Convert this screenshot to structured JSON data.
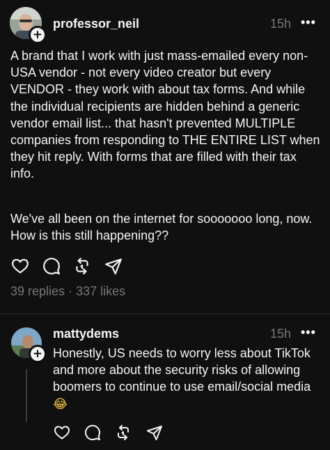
{
  "post": {
    "username": "professor_neil",
    "time": "15h",
    "more_label": "•••",
    "paragraph1": "A brand that I work with just mass-emailed every non-USA vendor - not every video creator but every VENDOR - they work with about tax forms. And while the individual recipients are hidden behind a generic vendor email list... that hasn't prevented MULTIPLE companies from responding to THE ENTIRE LIST when they hit reply. With forms that are filled with their tax info.",
    "paragraph2": "We've all been on the internet for sooooooo long, now. How is this still happening??",
    "stats": "39 replies · 337 likes",
    "plus_label": "+"
  },
  "reply": {
    "username": "mattydems",
    "time": "15h",
    "more_label": "•••",
    "text": "Honestly, US needs to worry less about TikTok and more about the security risks of allowing boomers to continue to use email/social media",
    "emoji": "😂",
    "plus_label": "+"
  },
  "icons": {
    "like": "heart-icon",
    "comment": "comment-icon",
    "repost": "repost-icon",
    "share": "send-icon"
  },
  "colors": {
    "background": "#101010",
    "text": "#f3f5f7",
    "muted": "#777777"
  }
}
